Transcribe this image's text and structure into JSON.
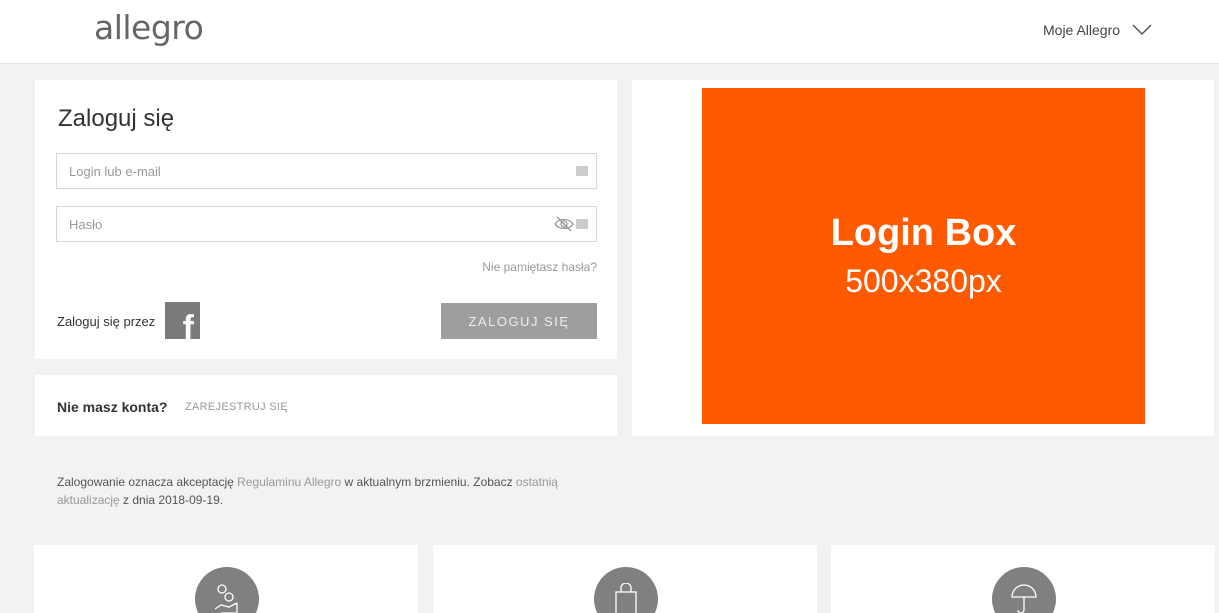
{
  "header": {
    "logo": "allegro",
    "account_menu": "Moje Allegro"
  },
  "login": {
    "title": "Zaloguj się",
    "login_placeholder": "Login lub e-mail",
    "password_placeholder": "Hasło",
    "forgot_password": "Nie pamiętasz hasła?",
    "login_via": "Zaloguj się przez",
    "login_button": "ZALOGUJ SIĘ"
  },
  "register": {
    "question": "Nie masz konta?",
    "link": "ZAREJESTRUJ SIĘ"
  },
  "ad": {
    "title": "Login Box",
    "subtitle": "500x380px",
    "color": "#ff5a00"
  },
  "terms": {
    "part1": "Zalogowanie oznacza akceptację ",
    "link1": "Regulaminu Allegro",
    "part2": " w aktualnym brzmieniu. Zobacz ",
    "link2": "ostatnią aktualizację",
    "part3": " z dnia 2018-09-19."
  },
  "features": [
    {
      "icon": "coins-hand-icon"
    },
    {
      "icon": "shopping-bag-icon"
    },
    {
      "icon": "umbrella-icon"
    }
  ]
}
